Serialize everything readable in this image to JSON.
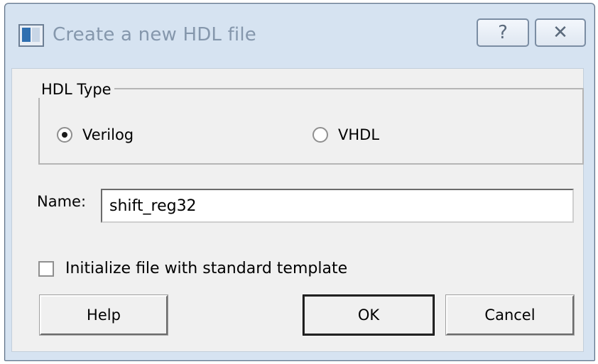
{
  "window": {
    "title": "Create a new HDL file",
    "help_button": "?",
    "close_button": "✕"
  },
  "hdl_type": {
    "legend": "HDL Type",
    "options": [
      {
        "label": "Verilog",
        "selected": true
      },
      {
        "label": "VHDL",
        "selected": false
      }
    ]
  },
  "name": {
    "label": "Name:",
    "value": "shift_reg32"
  },
  "template_checkbox": {
    "label": "Initialize file with standard template",
    "checked": false
  },
  "buttons": {
    "help": "Help",
    "ok": "OK",
    "cancel": "Cancel"
  }
}
